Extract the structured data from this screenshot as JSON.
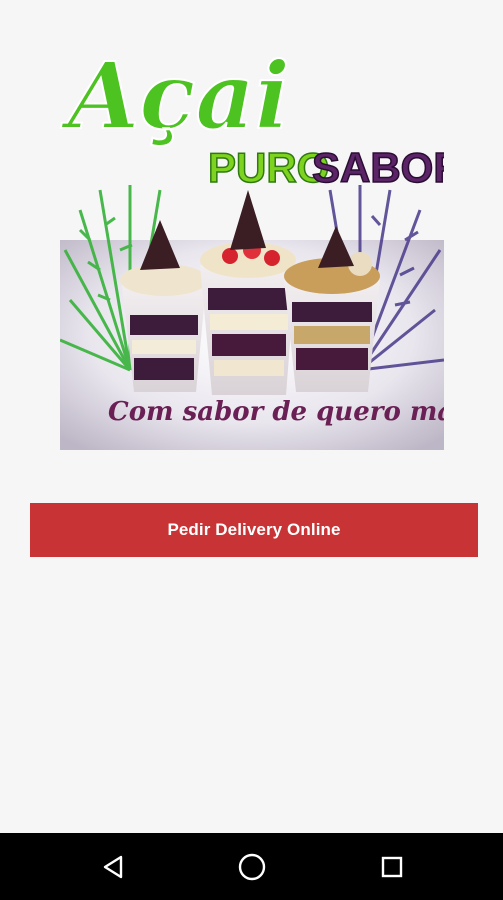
{
  "banner": {
    "brand_title": "Açai",
    "brand_subtitle_word1": "PURO",
    "brand_subtitle_word2": "SABOR",
    "tagline": "Com sabor de quero mais"
  },
  "actions": {
    "delivery_button_label": "Pedir Delivery Online"
  },
  "navigation_bar": {
    "back_icon": "back-triangle-icon",
    "home_icon": "home-circle-icon",
    "recents_icon": "recents-square-icon"
  },
  "colors": {
    "background": "#f7f6f7",
    "button": "#c83436",
    "brand_green": "#4cc320",
    "brand_purple": "#5a2466",
    "nav_bar": "#000000"
  }
}
